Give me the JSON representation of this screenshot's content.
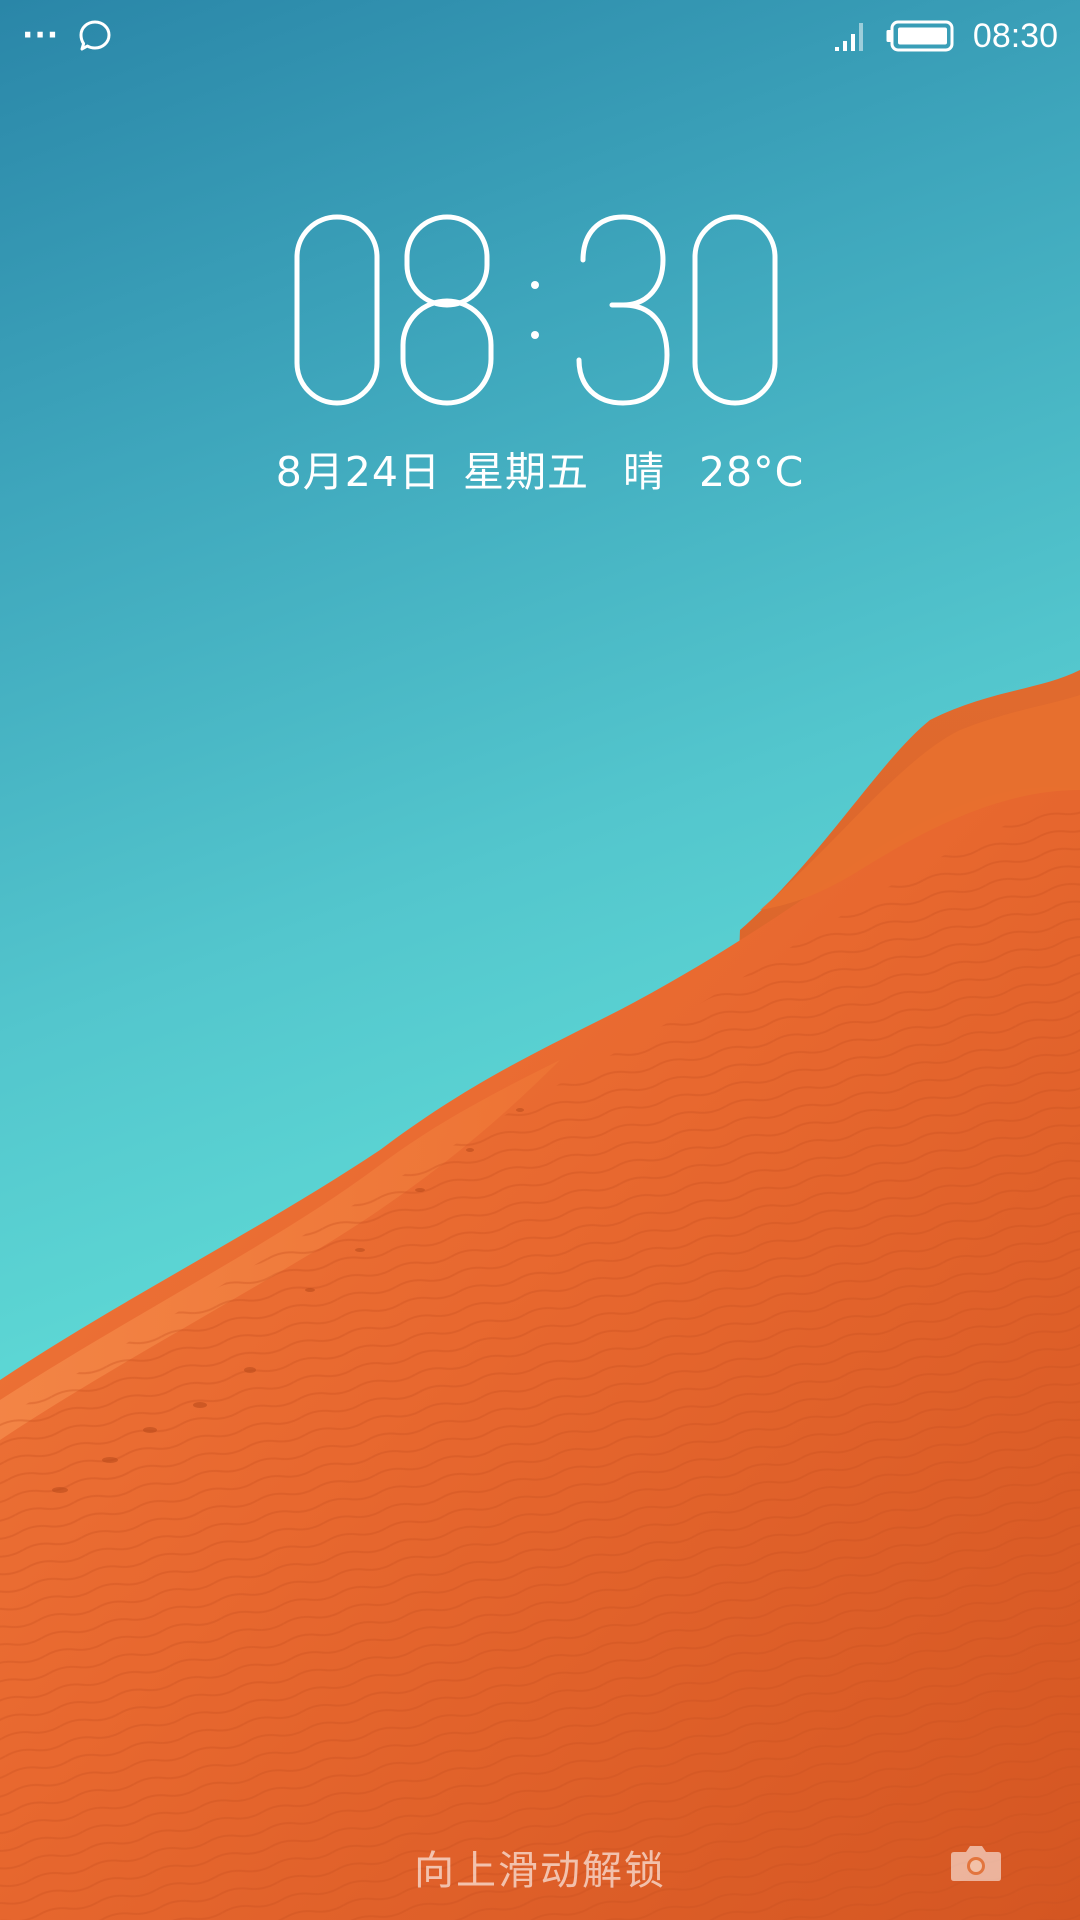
{
  "status_bar": {
    "time": "08:30",
    "overflow_icon": "more-dots-icon",
    "chat_icon": "chat-bubble-icon",
    "signal_icon": "signal-icon",
    "battery_icon": "battery-icon"
  },
  "lockscreen": {
    "clock_hours": "08",
    "clock_minutes": "30",
    "date": "8月24日",
    "weekday": "星期五",
    "weather": "晴",
    "temperature": "28°C",
    "unlock_hint": "向上滑动解锁",
    "camera_icon": "camera-icon"
  },
  "colors": {
    "sky_top": "#2a86a8",
    "sky_bottom": "#5fdcd6",
    "dune_orange": "#e8652b"
  }
}
